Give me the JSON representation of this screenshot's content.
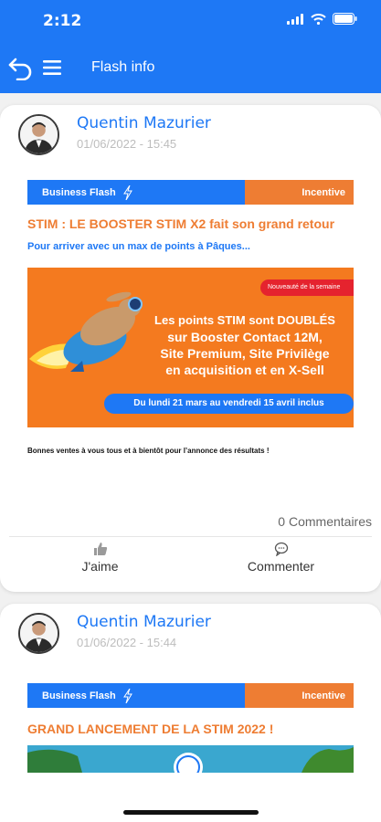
{
  "status_bar": {
    "time": "2:12"
  },
  "nav": {
    "title": "Flash info"
  },
  "posts": [
    {
      "author": "Quentin Mazurier",
      "date": "01/06/2022 - 15:45",
      "banner_left": "Business Flash",
      "banner_right": "Incentive",
      "title": "STIM : LE BOOSTER STIM X2 fait son grand retour",
      "subtitle": "Pour arriver avec un max de points à Pâques...",
      "promo": {
        "badge": "Nouveauté de la semaine",
        "headline": "Les points STIM sont DOUBLÉS",
        "lines": [
          "sur Booster Contact 12M,",
          "Site Premium, Site Privilège",
          "en acquisition et en X-Sell"
        ],
        "dates": "Du lundi 21 mars au vendredi 15 avril inclus"
      },
      "body": "Bonnes ventes à vous tous et à bientôt pour l’annonce des résultats !",
      "comments_count": "0 Commentaires",
      "like_label": "J'aime",
      "comment_label": "Commenter"
    },
    {
      "author": "Quentin Mazurier",
      "date": "01/06/2022 - 15:44",
      "banner_left": "Business Flash",
      "banner_right": "Incentive",
      "title": "GRAND LANCEMENT DE LA STIM 2022 !"
    }
  ],
  "colors": {
    "primary": "#1e78f5",
    "accent": "#ee7d33",
    "badge_red": "#e5232e"
  }
}
